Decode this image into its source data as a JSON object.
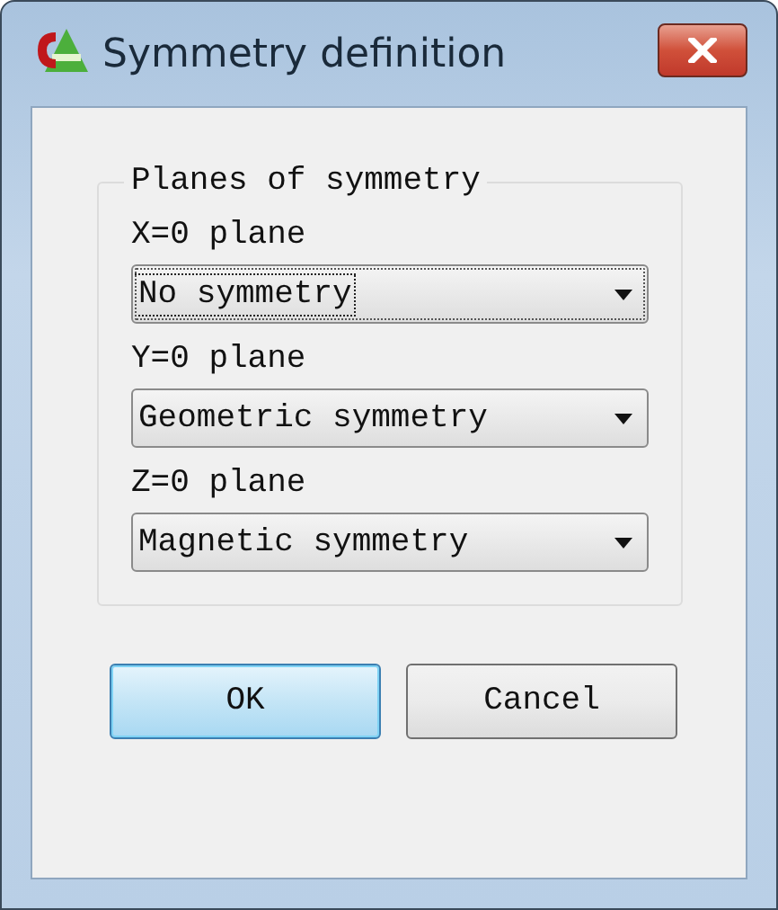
{
  "window": {
    "title": "Symmetry definition"
  },
  "group": {
    "title": "Planes of symmetry",
    "fields": [
      {
        "label": "X=0 plane",
        "value": "No symmetry",
        "focused": true
      },
      {
        "label": "Y=0 plane",
        "value": "Geometric symmetry",
        "focused": false
      },
      {
        "label": "Z=0 plane",
        "value": "Magnetic symmetry",
        "focused": false
      }
    ]
  },
  "buttons": [
    {
      "label": "OK",
      "default": true
    },
    {
      "label": "Cancel",
      "default": false
    }
  ]
}
